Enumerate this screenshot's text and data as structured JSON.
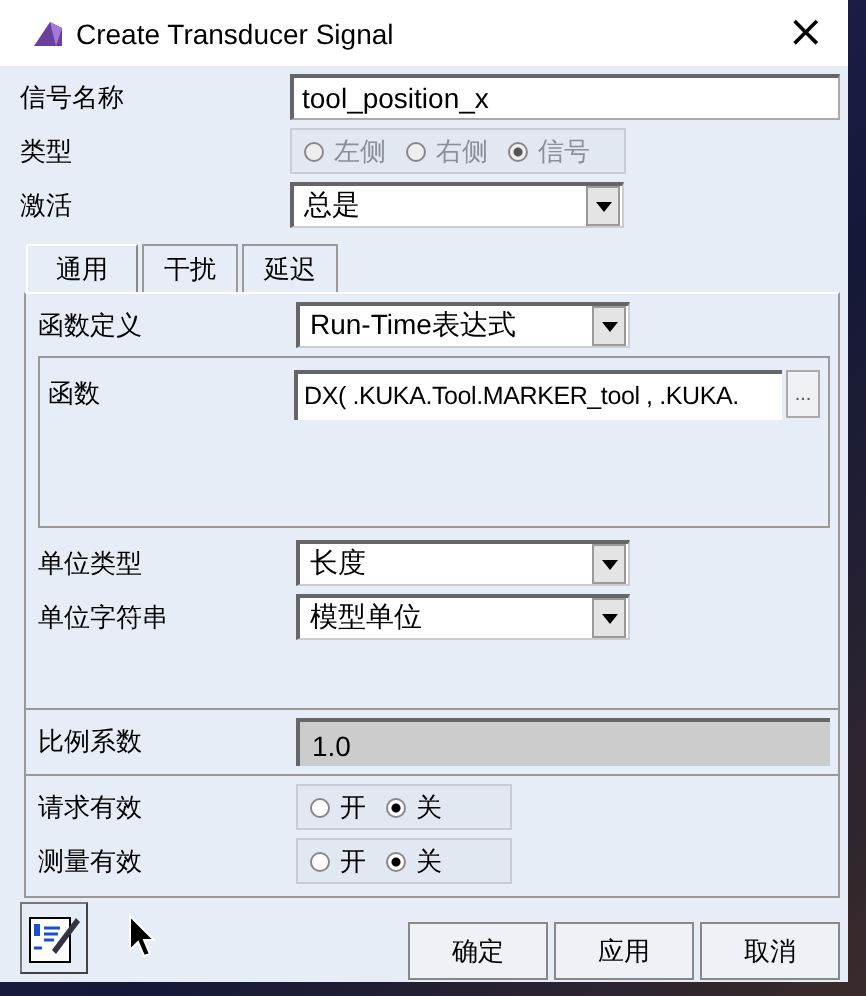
{
  "window": {
    "title": "Create Transducer Signal",
    "close": "×"
  },
  "signal_name": {
    "label": "信号名称",
    "value": "tool_position_x"
  },
  "type": {
    "label": "类型",
    "disabled": true,
    "options": [
      {
        "label": "左侧",
        "selected": false
      },
      {
        "label": "右侧",
        "selected": false
      },
      {
        "label": "信号",
        "selected": true
      }
    ]
  },
  "activate": {
    "label": "激活",
    "value": "总是"
  },
  "tabs": [
    {
      "label": "通用",
      "selected": true
    },
    {
      "label": "干扰",
      "selected": false
    },
    {
      "label": "延迟",
      "selected": false
    }
  ],
  "function_definition": {
    "label": "函数定义",
    "value": "Run-Time表达式"
  },
  "function": {
    "label": "函数",
    "value": "DX( .KUKA.Tool.MARKER_tool , .KUKA.",
    "button": "..."
  },
  "unit_type": {
    "label": "单位类型",
    "value": "长度"
  },
  "unit_string": {
    "label": "单位字符串",
    "value": "模型单位"
  },
  "scale": {
    "label": "比例系数",
    "value": "1.0",
    "disabled": true
  },
  "toggles": [
    {
      "label": "请求有效",
      "options": [
        {
          "label": "开",
          "selected": false
        },
        {
          "label": "关",
          "selected": true
        }
      ]
    },
    {
      "label": "测量有效",
      "options": [
        {
          "label": "开",
          "selected": false
        },
        {
          "label": "关",
          "selected": true
        }
      ]
    }
  ],
  "buttons": [
    "确定",
    "应用",
    "取消"
  ]
}
